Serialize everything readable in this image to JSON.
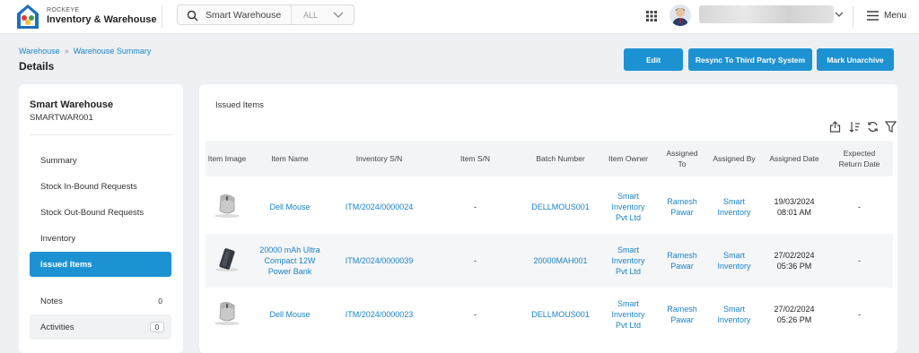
{
  "brand": {
    "small": "ROCKEYE",
    "title": "Inventory & Warehouse"
  },
  "search": {
    "value": "Smart Warehouse",
    "scope": "ALL"
  },
  "header": {
    "menu_label": "Menu"
  },
  "breadcrumb": [
    "Warehouse",
    "Warehouse Summary"
  ],
  "page_title": "Details",
  "actions": {
    "edit": "Edit",
    "resync": "Resync To Third Party System",
    "unarchive": "Mark Unarchive"
  },
  "warehouse": {
    "name": "Smart Warehouse",
    "code": "SMARTWAR001"
  },
  "nav": [
    {
      "label": "Summary"
    },
    {
      "label": "Stock In-Bound Requests"
    },
    {
      "label": "Stock Out-Bound Requests"
    },
    {
      "label": "Inventory"
    },
    {
      "label": "Issued Items"
    },
    {
      "label": "Notes",
      "count": "0"
    },
    {
      "label": "Activities",
      "count": "0"
    }
  ],
  "section_title": "Issued Items",
  "columns": [
    "Item Image",
    "Item Name",
    "Inventory S/N",
    "Item S/N",
    "Batch Number",
    "Item Owner",
    "Assigned To",
    "Assigned By",
    "Assigned Date",
    "Expected Return Date"
  ],
  "rows": [
    {
      "image": "mouse",
      "name": "Dell Mouse",
      "inv_sn": "ITM/2024/0000024",
      "item_sn": "-",
      "batch": "DELLMOUS001",
      "owner": "Smart Inventory Pvt Ltd",
      "assigned_to": "Ramesh Pawar",
      "assigned_by": "Smart Inventory",
      "date": "19/03/2024",
      "time": "08:01 AM",
      "return": "-"
    },
    {
      "image": "power-bank",
      "name": "20000 mAh Ultra Compact 12W Power Bank",
      "inv_sn": "ITM/2024/0000039",
      "item_sn": "-",
      "batch": "20000MAH001",
      "owner": "Smart Inventory Pvt Ltd",
      "assigned_to": "Ramesh Pawar",
      "assigned_by": "Smart Inventory",
      "date": "27/02/2024",
      "time": "05:36 PM",
      "return": "-"
    },
    {
      "image": "mouse",
      "name": "Dell Mouse",
      "inv_sn": "ITM/2024/0000023",
      "item_sn": "-",
      "batch": "DELLMOUS001",
      "owner": "Smart Inventory Pvt Ltd",
      "assigned_to": "Ramesh Pawar",
      "assigned_by": "Smart Inventory",
      "date": "27/02/2024",
      "time": "05:26 PM",
      "return": "-"
    }
  ],
  "colors": {
    "accent": "#1d92d3",
    "link": "#1a84c7"
  }
}
